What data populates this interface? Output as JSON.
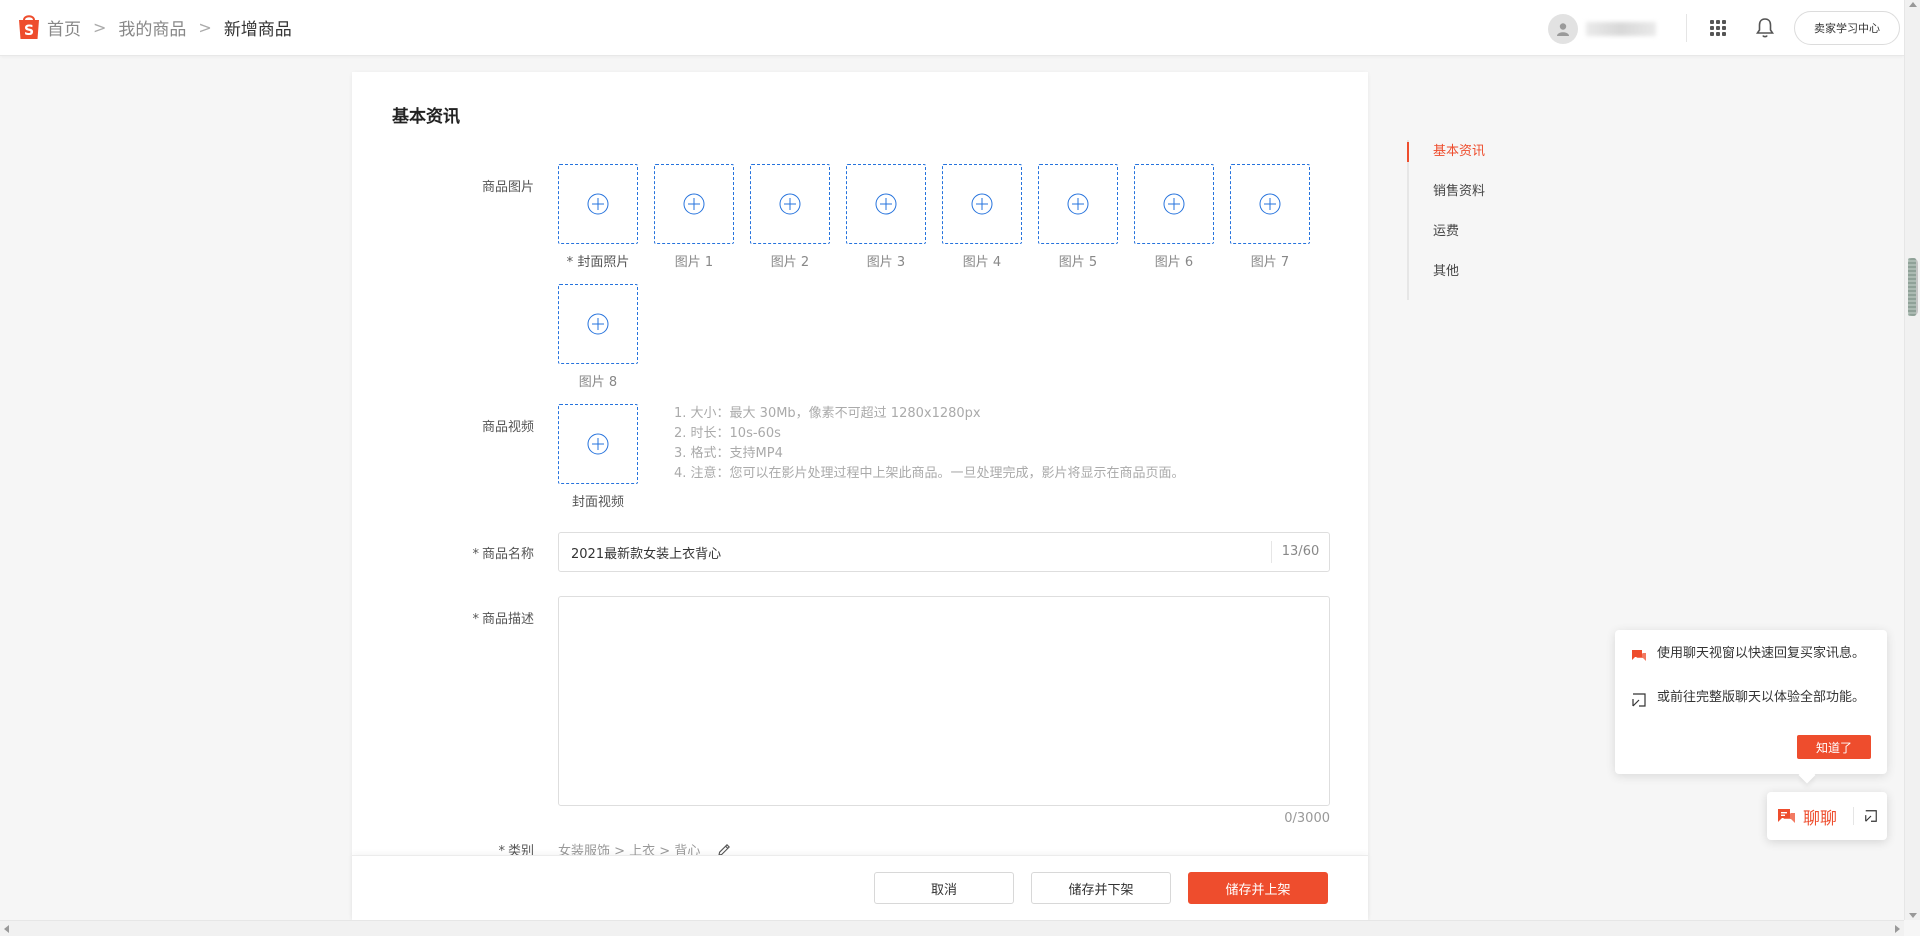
{
  "header": {
    "breadcrumbs": [
      "首页",
      "我的商品",
      "新增商品"
    ],
    "separator": ">",
    "learn_center": "卖家学习中心",
    "brand_color": "#ee4d2d"
  },
  "section": {
    "title": "基本资讯"
  },
  "images": {
    "label": "商品图片",
    "required_mark": "*",
    "slots": [
      "封面照片",
      "图片 1",
      "图片 2",
      "图片 3",
      "图片 4",
      "图片 5",
      "图片 6",
      "图片 7",
      "图片 8"
    ]
  },
  "video": {
    "label": "商品视频",
    "slot": "封面视频",
    "notes": [
      "1. 大小：最大 30Mb，像素不可超过 1280x1280px",
      "2. 时长：10s-60s",
      "3. 格式：支持MP4",
      "4. 注意：您可以在影片处理过程中上架此商品。一旦处理完成，影片将显示在商品页面。"
    ]
  },
  "name": {
    "label": "商品名称",
    "required_mark": "*",
    "value": "2021最新款女装上衣背心",
    "count": "13/60"
  },
  "description": {
    "label": "商品描述",
    "required_mark": "*",
    "value": "",
    "count": "0/3000"
  },
  "category": {
    "label": "类别",
    "required_mark": "*",
    "value": "女装服饰 > 上衣 > 背心"
  },
  "actions": {
    "cancel": "取消",
    "save_unlist": "储存并下架",
    "save_publish": "储存并上架"
  },
  "anchor_nav": {
    "items": [
      "基本资讯",
      "销售资料",
      "运费",
      "其他"
    ],
    "active_index": 0
  },
  "chat_tip": {
    "line1": "使用聊天视窗以快速回复买家讯息。",
    "line2": "或前往完整版聊天以体验全部功能。",
    "ok": "知道了"
  },
  "chat_button": {
    "label": "聊聊"
  }
}
